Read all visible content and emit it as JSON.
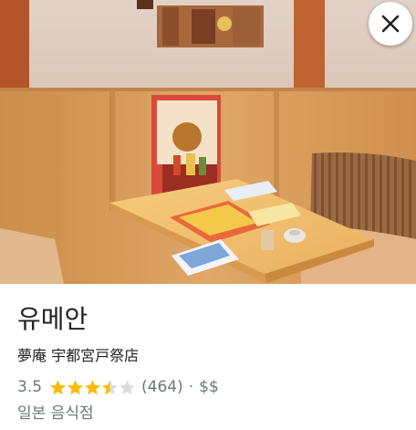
{
  "place": {
    "name": "유메안",
    "original_name": "夢庵 宇都宮戸祭店",
    "rating": "3.5",
    "rating_value": 3.5,
    "rating_max": 5,
    "reviews": "(464)",
    "separator": "·",
    "price": "$$",
    "category": "일본 음식점"
  },
  "colors": {
    "star_filled": "#fbbc04",
    "star_empty": "#dadce0",
    "secondary_text": "#70757a"
  },
  "icons": {
    "close": "close-icon",
    "star": "star-icon"
  }
}
